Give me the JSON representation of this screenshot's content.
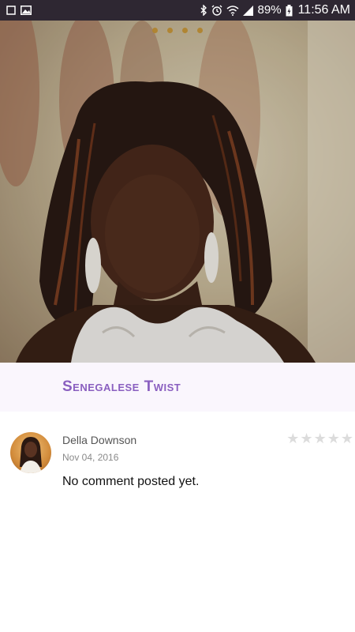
{
  "status_bar": {
    "battery": "89%",
    "time": "11:56 AM",
    "icons": [
      "notification-dot-icon",
      "image-icon",
      "bluetooth-icon",
      "alarm-icon",
      "wifi-icon",
      "signal-icon",
      "battery-charging-icon"
    ]
  },
  "carousel": {
    "dot_count": 4
  },
  "style": {
    "title_color": "#8a5fc0",
    "title_band_bg": "#faf6fd",
    "status_bar_bg": "#2e2732",
    "star_color": "#dcdcdc"
  },
  "style_title": "Senegalese Twist",
  "comment": {
    "author": "Della Downson",
    "date": "Nov 04, 2016",
    "text": "No comment posted yet.",
    "rating": 0,
    "max_rating": 5
  }
}
